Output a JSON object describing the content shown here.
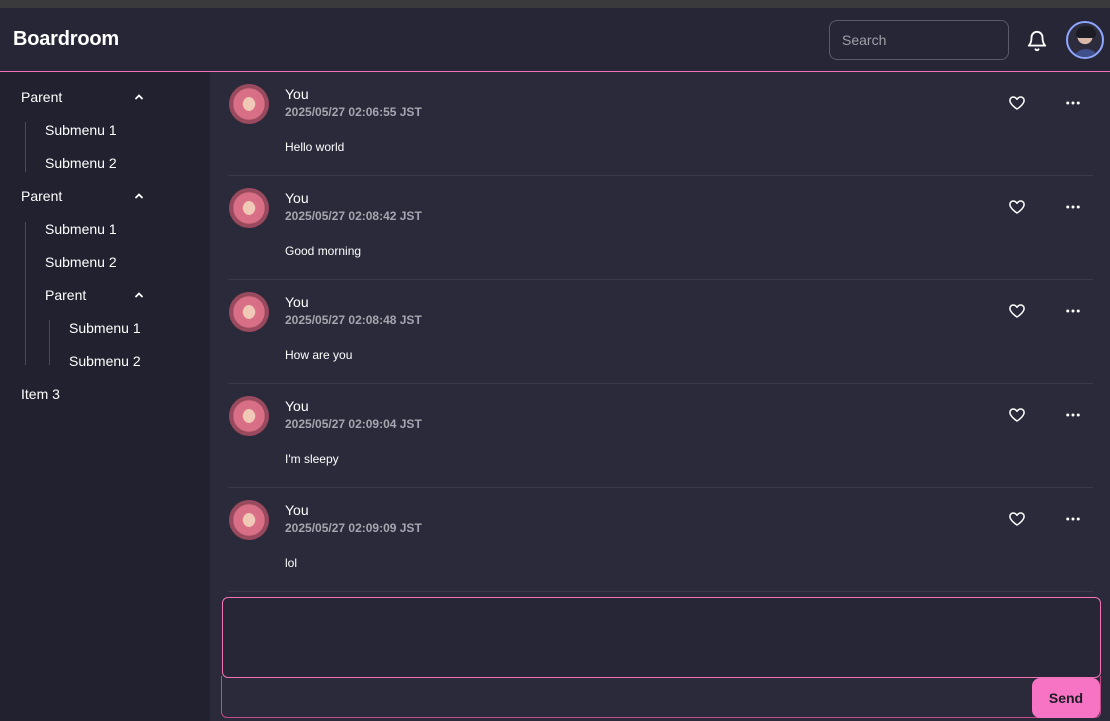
{
  "app": {
    "title": "Boardroom"
  },
  "header": {
    "search_placeholder": "Search"
  },
  "sidebar": {
    "items": [
      {
        "label": "Parent"
      },
      {
        "label": "Submenu 1"
      },
      {
        "label": "Submenu 2"
      },
      {
        "label": "Parent"
      },
      {
        "label": "Submenu 1"
      },
      {
        "label": "Submenu 2"
      },
      {
        "label": "Parent"
      },
      {
        "label": "Submenu 1"
      },
      {
        "label": "Submenu 2"
      },
      {
        "label": "Item 3"
      }
    ]
  },
  "messages": [
    {
      "author": "You",
      "timestamp": "2025/05/27 02:06:55 JST",
      "text": "Hello world"
    },
    {
      "author": "You",
      "timestamp": "2025/05/27 02:08:42 JST",
      "text": "Good morning"
    },
    {
      "author": "You",
      "timestamp": "2025/05/27 02:08:48 JST",
      "text": "How are you"
    },
    {
      "author": "You",
      "timestamp": "2025/05/27 02:09:04 JST",
      "text": "I'm sleepy"
    },
    {
      "author": "You",
      "timestamp": "2025/05/27 02:09:09 JST",
      "text": "lol"
    }
  ],
  "composer": {
    "value": "",
    "send_label": "Send"
  },
  "colors": {
    "accent": "#f472b6",
    "send_button": "#f774c4",
    "background": "#2a2a3a",
    "sidebar": "#21212f"
  },
  "icons": [
    "bell-icon",
    "user-avatar",
    "chevron-up-icon",
    "heart-icon",
    "more-icon"
  ]
}
